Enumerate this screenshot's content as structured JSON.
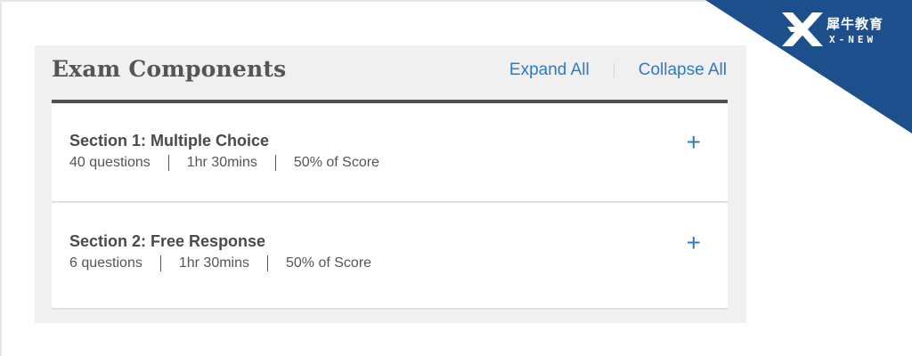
{
  "panel": {
    "title": "Exam Components",
    "expand_all": "Expand All",
    "collapse_all": "Collapse All"
  },
  "sections": [
    {
      "title": "Section 1: Multiple Choice",
      "questions": "40 questions",
      "time": "1hr 30mins",
      "score": "50% of Score",
      "toggle": "+"
    },
    {
      "title": "Section 2: Free Response",
      "questions": "6 questions",
      "time": "1hr 30mins",
      "score": "50% of Score",
      "toggle": "+"
    }
  ],
  "badge": {
    "name_cn": "犀牛教育",
    "name_en": "X-NEW",
    "color": "#1c4f8c"
  },
  "colors": {
    "accent": "#2f7ac0",
    "header_rule": "#4f4f4f",
    "panel_bg": "#f0f0f0"
  }
}
